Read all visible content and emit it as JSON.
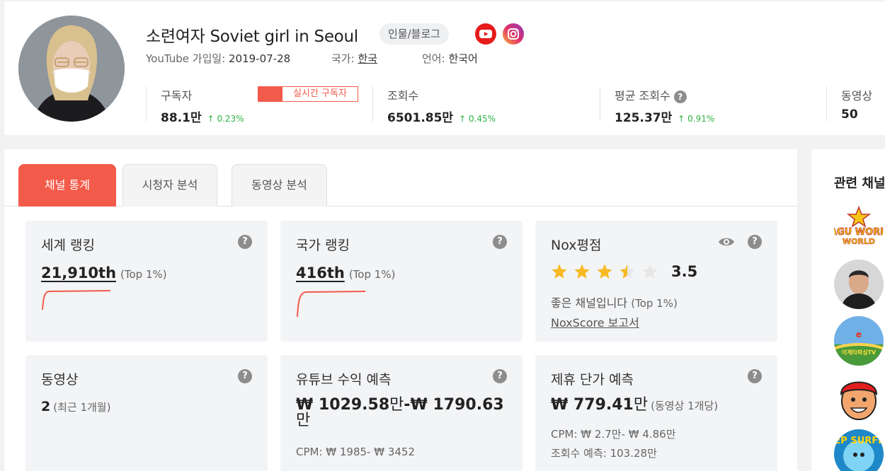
{
  "channel": {
    "name": "소련여자 Soviet girl in Seoul",
    "category": "인물/블로그",
    "joined_label": "YouTube 가입일:",
    "joined_value": "2019-07-28",
    "country_label": "국가:",
    "country_value": "한국",
    "language_label": "언어:",
    "language_value": "한국어"
  },
  "stats": {
    "subscribers": {
      "label": "구독자",
      "value": "88.1만",
      "change": "0.23%"
    },
    "live_badge": "실시간 구독자",
    "views": {
      "label": "조회수",
      "value": "6501.85만",
      "change": "0.45%"
    },
    "avg_views": {
      "label": "평균 조회수",
      "value": "125.37만",
      "change": "0.91%"
    },
    "videos": {
      "label": "동영상",
      "value": "50"
    }
  },
  "tabs": [
    "채널 통계",
    "시청자 분석",
    "동영상 분석"
  ],
  "cards": {
    "world_rank": {
      "title": "세계 랭킹",
      "value": "21,910th",
      "top": "(Top 1%)"
    },
    "country_rank": {
      "title": "국가 랭킹",
      "value": "416th",
      "top": "(Top 1%)"
    },
    "nox": {
      "title": "Nox평점",
      "score": "3.5",
      "rating": 3.5,
      "desc": "좋은 채널입니다",
      "top": "(Top 1%)",
      "report": "NoxScore 보고서"
    },
    "videos": {
      "title": "동영상",
      "value": "2",
      "sub": "(최근 1개월)"
    },
    "revenue": {
      "title": "유튜브 수익 예측",
      "currency": "₩",
      "low": "1029.58",
      "high": "1790.63",
      "unit": "만",
      "separator": "-",
      "cpm": "CPM: ₩ 1985- ₩ 3452"
    },
    "affiliate": {
      "title": "제휴 단가 예측",
      "currency": "₩",
      "value": "779.41",
      "unit": "만",
      "sub": "(동영상 1개당)",
      "cpm": "CPM: ₩ 2.7만- ₩ 4.86만",
      "views": "조회수 예측: 103.28만"
    }
  },
  "sidebar": {
    "title": "관련 채널",
    "channels": [
      "YAGU WORLD",
      "",
      "이게타파싱TV",
      "",
      "KEEP SURFING"
    ]
  },
  "colors": {
    "accent": "#f25a4a",
    "up": "#2fb344",
    "star": "#f7b924"
  }
}
